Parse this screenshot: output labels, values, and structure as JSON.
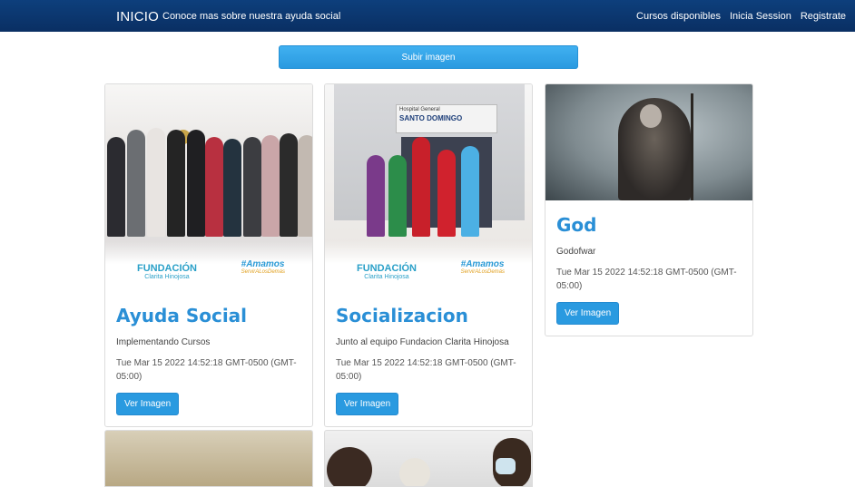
{
  "navbar": {
    "brand": "INICIO",
    "about_link": "Conoce mas sobre nuestra ayuda social",
    "links": [
      "Cursos disponibles",
      "Inicia Session",
      "Registrate"
    ]
  },
  "upload_button": "Subir imagen",
  "cards": [
    {
      "title": "Ayuda Social",
      "subtitle": "Implementando Cursos",
      "date": "Tue Mar 15 2022 14:52:18 GMT-0500 (GMT-05:00)",
      "button": "Ver Imagen",
      "image_text": [
        "FUNDACIÓN",
        "Clarita Hinojosa",
        "#Amamos",
        "ServirALosDemás"
      ]
    },
    {
      "title": "Socializacion",
      "subtitle": "Junto al equipo Fundacion Clarita Hinojosa",
      "date": "Tue Mar 15 2022 14:52:18 GMT-0500 (GMT-05:00)",
      "button": "Ver Imagen",
      "image_text": [
        "FUNDACIÓN",
        "Clarita Hinojosa",
        "#Amamos",
        "ServirALosDemás",
        "Hospital General",
        "SANTO DOMINGO"
      ]
    },
    {
      "title": "God",
      "subtitle": "Godofwar",
      "date": "Tue Mar 15 2022 14:52:18 GMT-0500 (GMT-05:00)",
      "button": "Ver Imagen"
    }
  ]
}
